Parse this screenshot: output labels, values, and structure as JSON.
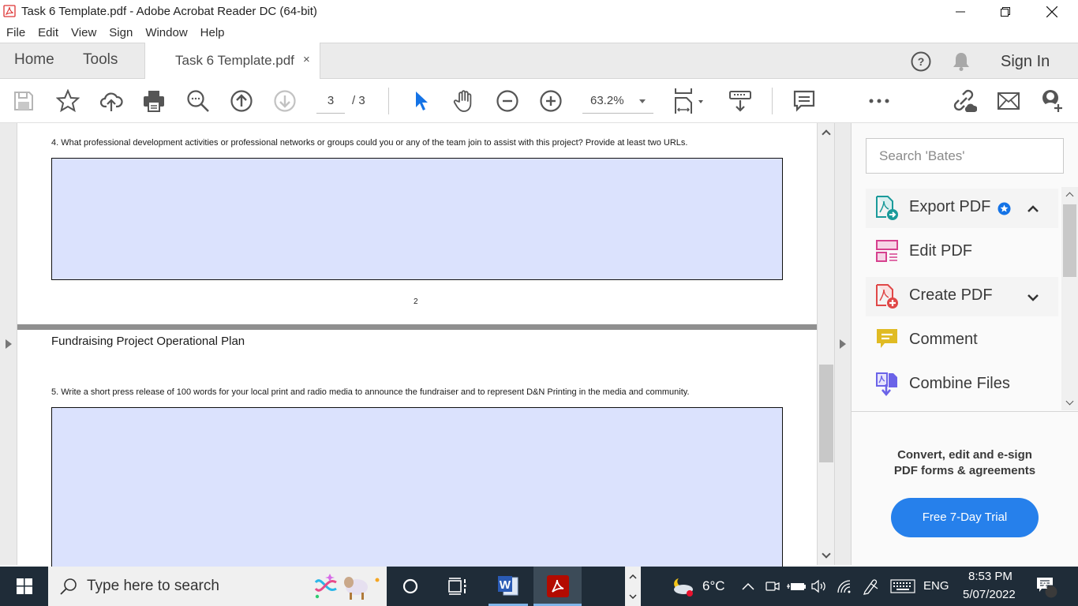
{
  "window": {
    "title": "Task 6 Template.pdf - Adobe Acrobat Reader DC (64-bit)",
    "controls": [
      "minimize",
      "restore",
      "close"
    ]
  },
  "menu": [
    "File",
    "Edit",
    "View",
    "Sign",
    "Window",
    "Help"
  ],
  "tabs": {
    "home": "Home",
    "tools": "Tools",
    "document": "Task 6 Template.pdf",
    "close_symbol": "×",
    "sign_in": "Sign In"
  },
  "toolbar": {
    "current_page": "3",
    "total_pages": "/ 3",
    "zoom": "63.2%",
    "icons": [
      "save-icon",
      "star-icon",
      "upload-cloud-icon",
      "print-icon",
      "search-zoom-icon",
      "page-up-icon",
      "page-down-icon",
      "select-cursor-icon",
      "hand-icon",
      "zoom-out-icon",
      "zoom-in-icon",
      "fit-page-icon",
      "scroll-mode-icon",
      "comment-icon",
      "more-icon",
      "share-link-icon",
      "email-icon",
      "add-user-icon"
    ]
  },
  "document": {
    "q4": "4. What professional development activities or professional networks or groups could you or any of the team join to assist with this project? Provide at least two URLs.",
    "q4_answer": "",
    "page_number": "2",
    "section_title": "Fundraising Project Operational Plan",
    "q5": "5. Write a short press release of 100 words for your local print and radio media to announce the fundraiser and to represent D&N Printing in the media and community.",
    "q5_answer": "",
    "field_color": "#dbe2fd"
  },
  "right_pane": {
    "search_placeholder": "Search 'Bates'",
    "tools": [
      {
        "label": "Export PDF",
        "icon": "export-pdf-icon",
        "color": "#1a9a9a",
        "badge": "premium-star-icon",
        "expand": "collapse"
      },
      {
        "label": "Edit PDF",
        "icon": "edit-pdf-icon",
        "color": "#d6408e"
      },
      {
        "label": "Create PDF",
        "icon": "create-pdf-icon",
        "color": "#e04848",
        "expand": "expand"
      },
      {
        "label": "Comment",
        "icon": "comment-icon",
        "color": "#e0bb23"
      },
      {
        "label": "Combine Files",
        "icon": "combine-files-icon",
        "color": "#6b63e8"
      }
    ],
    "promo_text": "Convert, edit and e-sign PDF forms & agreements",
    "trial_button": "Free 7-Day Trial",
    "accent": "#2680eb"
  },
  "taskbar": {
    "search_placeholder": "Type here to search",
    "apps": [
      "cortana-icon",
      "task-view-icon",
      "word-icon",
      "acrobat-icon"
    ],
    "weather": "6°C",
    "language": "ENG",
    "time": "8:53 PM",
    "date": "5/07/2022",
    "notifications": "2"
  }
}
